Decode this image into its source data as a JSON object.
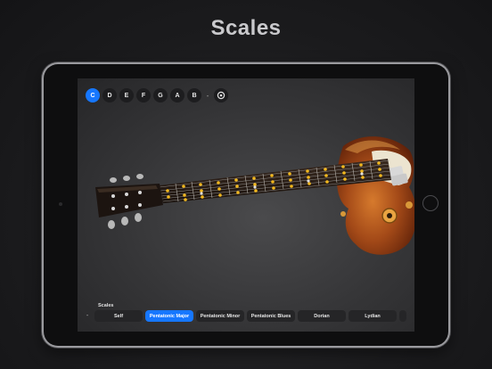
{
  "headline": "Scales",
  "notes": {
    "items": [
      "C",
      "D",
      "E",
      "F",
      "G",
      "A",
      "B"
    ],
    "selected": "C",
    "separator": "-"
  },
  "scales": {
    "label": "Scales",
    "prev": "-",
    "items": [
      "Self",
      "Pentatonic Major",
      "Pentatonic Minor",
      "Pentatonic Blues",
      "Dorian",
      "Lydian"
    ],
    "selected": "Pentatonic Major"
  },
  "colors": {
    "accent": "#1677ff",
    "fret_marker": "#f2b81e",
    "guitar_body": "#8a3d17",
    "pickguard": "#e6ddc6"
  },
  "icons": {
    "settings": "gear-icon"
  }
}
